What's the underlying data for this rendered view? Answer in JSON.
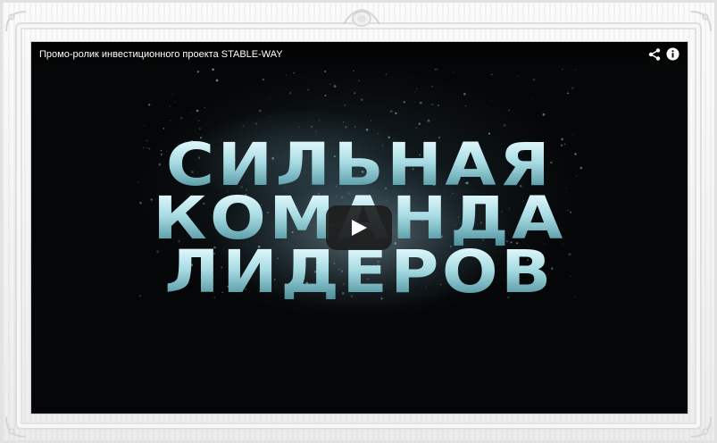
{
  "video": {
    "title": "Промо-ролик инвестиционного проекта STABLE-WAY",
    "headline": [
      "СИЛЬНАЯ",
      "КОМАНДА",
      "ЛИДЕРОВ"
    ]
  },
  "controls": {
    "share_icon": "share-icon",
    "info_icon": "info-icon",
    "play_icon": "play-icon"
  },
  "colors": {
    "player_background": "#050607",
    "headline_color": "#a7dbe2",
    "frame_background": "#f4f4f4"
  }
}
